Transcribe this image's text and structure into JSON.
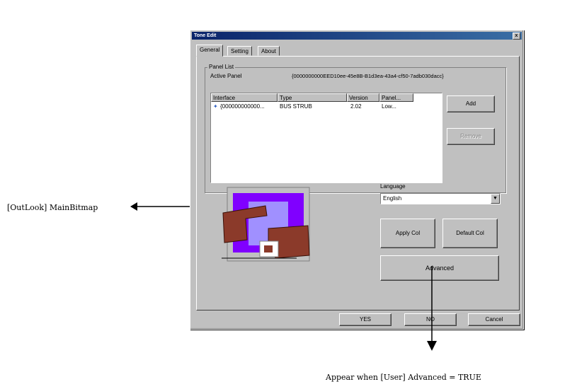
{
  "dialog": {
    "title": "Tone Edit",
    "close_label": "x",
    "tabs": [
      {
        "label": "General",
        "active": true
      },
      {
        "label": "Setting",
        "active": false
      },
      {
        "label": "About",
        "active": false
      }
    ],
    "group": {
      "title": "Panel List",
      "active_panel_label": "Active Panel",
      "active_panel_value": "{0000000000EED10ee-45e8B-B1d3ea-43a4-cf50-7adb030dacc}"
    },
    "list": {
      "columns": [
        "Interface",
        "Type",
        "Version",
        "Panel..."
      ],
      "rows": [
        {
          "interface": "{000000000000...",
          "type": "BUS STRUB",
          "version": "2.02",
          "panel": "Low..."
        }
      ]
    },
    "add_button": "Add",
    "remove_button": "Remove",
    "language_label": "Language",
    "language_value": "English",
    "apply_color_button": "Apply Col",
    "default_color_button": "Default Col",
    "advanced_button": "Advanced",
    "yes_button": "YES",
    "no_button": "NO",
    "cancel_button": "Cancel"
  },
  "annotations": {
    "left": "[OutLook] MainBitmap",
    "bottom": "Appear when [User] Advanced = TRUE"
  },
  "colors": {
    "dialog_bg": "#c0c0c0",
    "titlebar": "#0a246a",
    "bitmap_purple": "#8000ff",
    "bitmap_lavender": "#a090ff",
    "bitmap_brown": "#8b3a2a"
  }
}
